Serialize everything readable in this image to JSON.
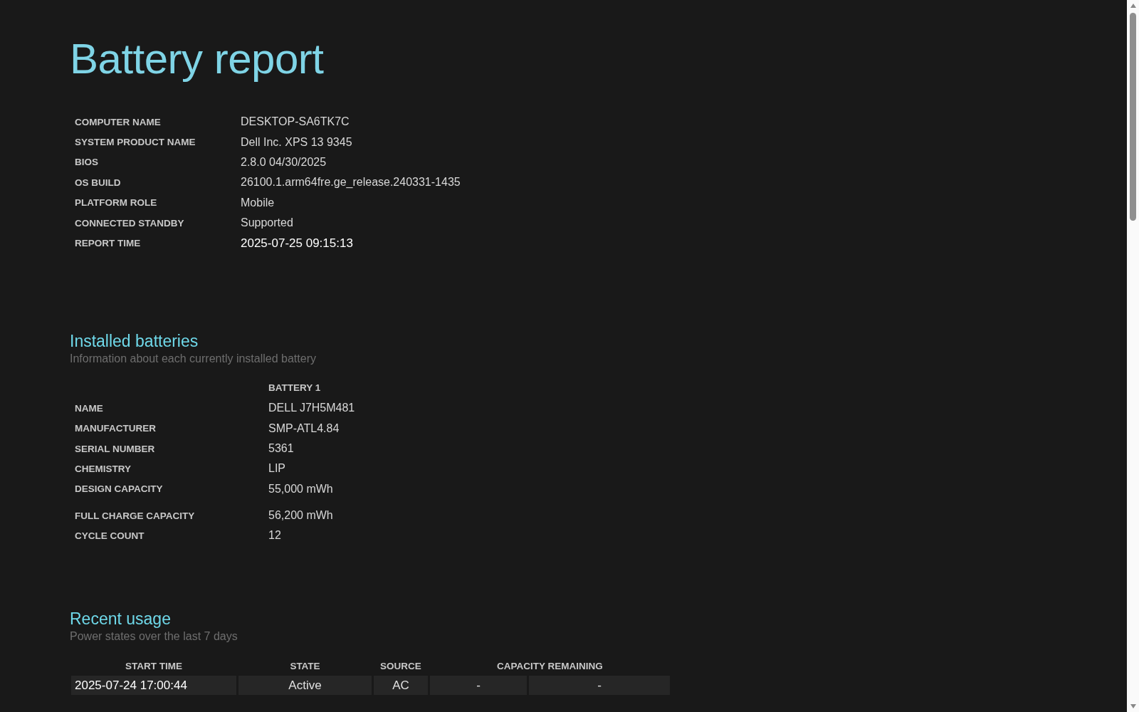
{
  "title": "Battery report",
  "system_info": [
    {
      "label": "COMPUTER NAME",
      "value": "DESKTOP-SA6TK7C"
    },
    {
      "label": "SYSTEM PRODUCT NAME",
      "value": "Dell Inc. XPS 13 9345"
    },
    {
      "label": "BIOS",
      "value": "2.8.0 04/30/2025"
    },
    {
      "label": "OS BUILD",
      "value": "26100.1.arm64fre.ge_release.240331-1435"
    },
    {
      "label": "PLATFORM ROLE",
      "value": "Mobile"
    },
    {
      "label": "CONNECTED STANDBY",
      "value": "Supported"
    },
    {
      "label": "REPORT TIME",
      "value": "2025-07-25  09:15:13"
    }
  ],
  "installed_batteries": {
    "heading": "Installed batteries",
    "subtitle": "Information about each currently installed battery",
    "column": "BATTERY 1",
    "rows": [
      {
        "label": "NAME",
        "value": "DELL J7H5M481"
      },
      {
        "label": "MANUFACTURER",
        "value": "SMP-ATL4.84"
      },
      {
        "label": "SERIAL NUMBER",
        "value": "5361"
      },
      {
        "label": "CHEMISTRY",
        "value": "LIP"
      },
      {
        "label": "DESIGN CAPACITY",
        "value": "55,000 mWh"
      },
      {
        "label": "FULL CHARGE CAPACITY",
        "value": "56,200 mWh"
      },
      {
        "label": "CYCLE COUNT",
        "value": "12"
      }
    ]
  },
  "recent_usage": {
    "heading": "Recent usage",
    "subtitle": "Power states over the last 7 days",
    "columns": [
      "START TIME",
      "STATE",
      "SOURCE",
      "CAPACITY REMAINING"
    ],
    "rows": [
      {
        "start_time": "2025-07-24  17:00:44",
        "state": "Active",
        "source": "AC",
        "capacity_1": "-",
        "capacity_2": "-"
      }
    ]
  }
}
